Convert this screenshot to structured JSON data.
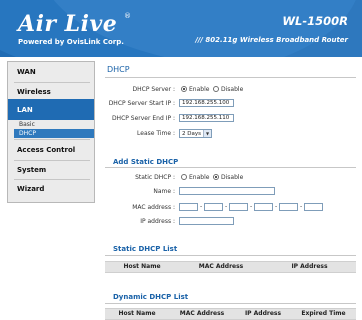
{
  "header": {
    "logo": "Air Live",
    "logo_mark": "®",
    "logo_sub": "Powered by OvisLink Corp.",
    "model": "WL-1500R",
    "tagline": "/// 802.11g Wireless Broadband Router"
  },
  "sidebar": {
    "items": [
      {
        "label": "WAN"
      },
      {
        "label": "Wireless"
      },
      {
        "label": "LAN"
      },
      {
        "label": "Access Control"
      },
      {
        "label": "System"
      },
      {
        "label": "Wizard"
      }
    ],
    "lan_sub": [
      {
        "label": "Basic"
      },
      {
        "label": "DHCP"
      }
    ]
  },
  "dhcp": {
    "title": "DHCP",
    "server_label": "DHCP Server :",
    "enable": "Enable",
    "disable": "Disable",
    "server_state": "enable",
    "start_label": "DHCP Server Start IP :",
    "start_value": "192.168.255.100",
    "end_label": "DHCP Server End IP :",
    "end_value": "192.168.255.110",
    "lease_label": "Lease Time :",
    "lease_value": "2 Days"
  },
  "static_dhcp": {
    "title": "Add Static DHCP",
    "static_label": "Static DHCP :",
    "enable": "Enable",
    "disable": "Disable",
    "state": "disable",
    "name_label": "Name :",
    "mac_label": "MAC address :",
    "mac_sep": "-",
    "ip_label": "IP address :"
  },
  "static_list": {
    "title": "Static DHCP List",
    "columns": [
      "Host Name",
      "MAC Address",
      "IP Address"
    ]
  },
  "dynamic_list": {
    "title": "Dynamic DHCP List",
    "columns": [
      "Host Name",
      "MAC Address",
      "IP Address",
      "Expired Time"
    ]
  },
  "colors": {
    "brand_blue": "#1f6bb3",
    "section_title": "#1a62a8"
  }
}
